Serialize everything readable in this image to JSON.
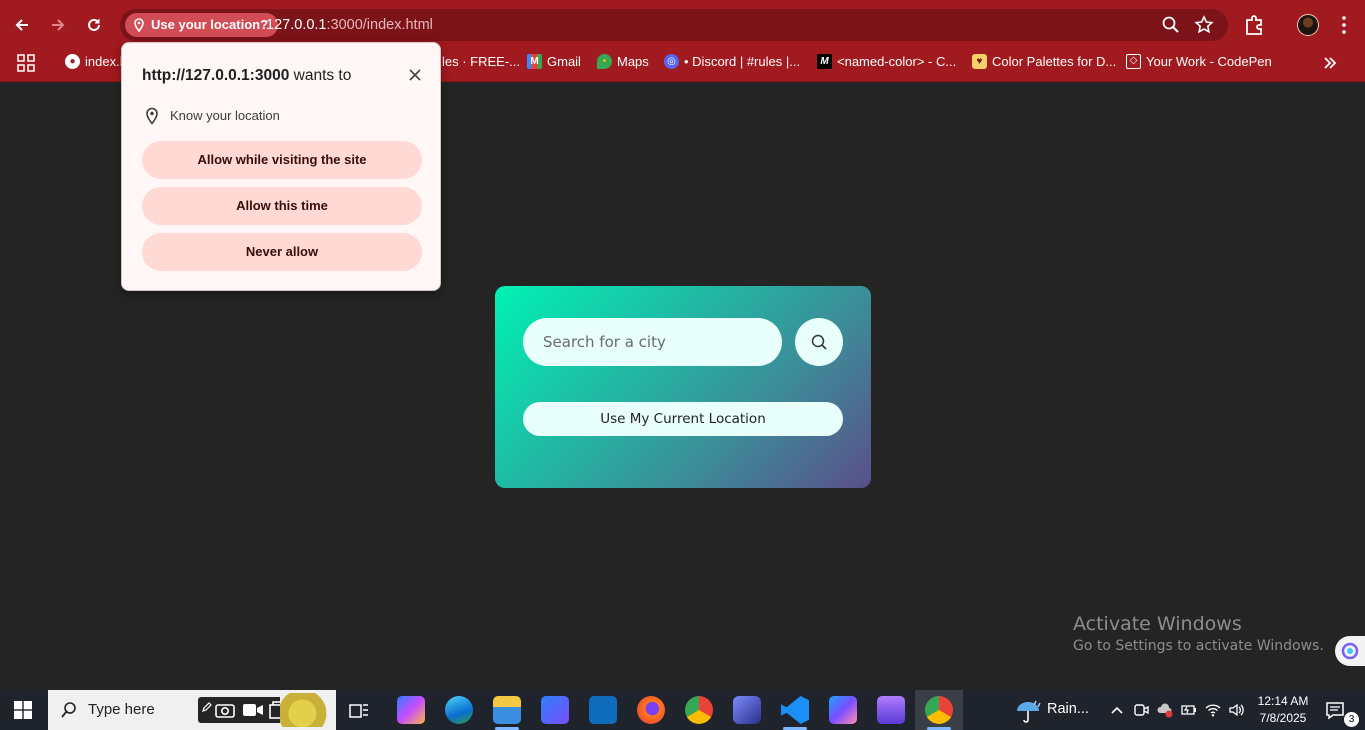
{
  "browser": {
    "location_chip": "Use your location?",
    "url_host": "127.0.0.1",
    "url_path": ":3000/index.html"
  },
  "bookmarks": [
    {
      "label": "index.h",
      "icon": "globe-icon"
    },
    {
      "label": "les · FREE-...",
      "icon": "page-icon"
    },
    {
      "label": "Gmail",
      "icon": "gmail-icon"
    },
    {
      "label": "Maps",
      "icon": "maps-icon"
    },
    {
      "label": "• Discord | #rules |...",
      "icon": "discord-icon"
    },
    {
      "label": "<named-color> - C...",
      "icon": "mdn-icon"
    },
    {
      "label": "Color Palettes for D...",
      "icon": "palette-icon"
    },
    {
      "label": "Your Work - CodePen",
      "icon": "codepen-icon"
    }
  ],
  "popup": {
    "origin": "http://127.0.0.1:3000",
    "title_suffix": " wants to",
    "permission": "Know your location",
    "buttons": [
      "Allow while visiting the site",
      "Allow this time",
      "Never allow"
    ]
  },
  "app": {
    "search_placeholder": "Search for a city",
    "location_button": "Use My Current Location"
  },
  "watermark": {
    "line1": "Activate Windows",
    "line2": "Go to Settings to activate Windows."
  },
  "taskbar": {
    "search_text": "Type here",
    "weather": "Rain...",
    "time": "12:14 AM",
    "date": "7/8/2025",
    "notifications": "3"
  },
  "colors": {
    "browser_frame": "#a11a1f",
    "card_gradient_start": "#00f2b4",
    "card_gradient_end": "#5a4f8a",
    "popup_button": "#ffd9d4"
  }
}
